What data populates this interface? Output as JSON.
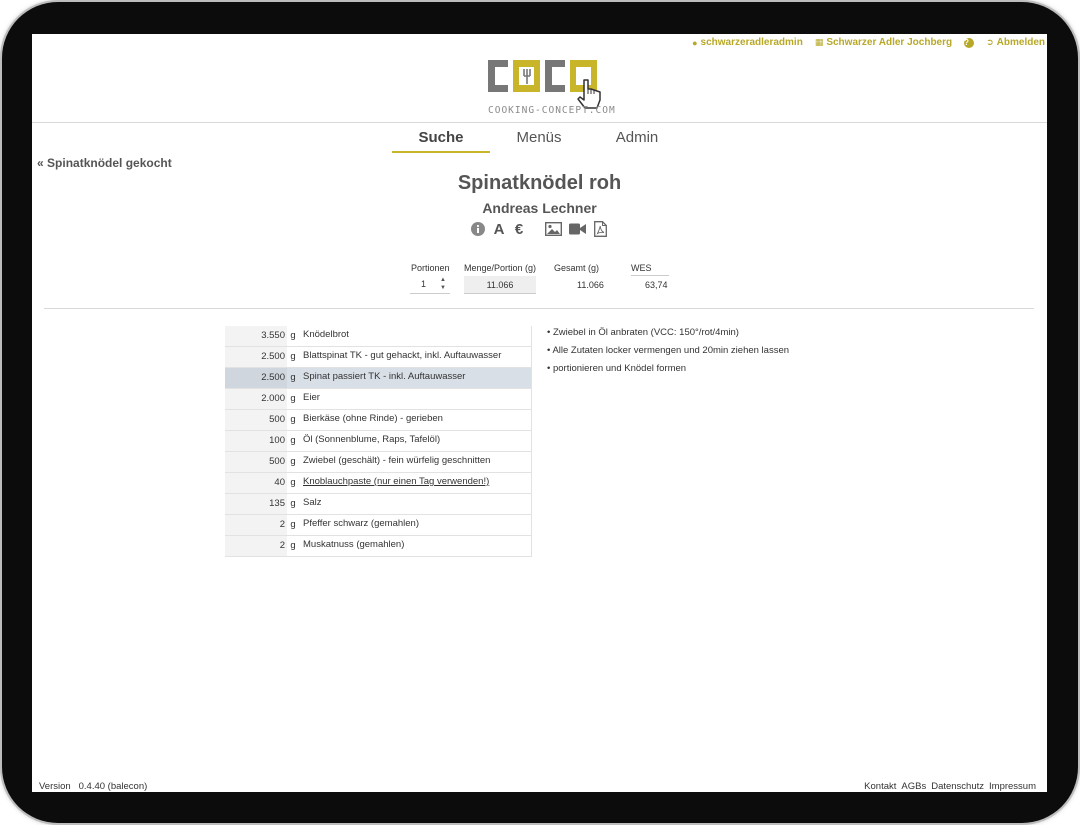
{
  "userbar": {
    "username": "schwarzeradleradmin",
    "hotel": "Schwarzer Adler Jochberg",
    "help": "?",
    "logout": "Abmelden"
  },
  "logo": {
    "subtitle": "COOKING-CONCEPT.COM"
  },
  "nav": {
    "tabs": [
      {
        "label": "Suche",
        "active": true
      },
      {
        "label": "Menüs"
      },
      {
        "label": "Admin"
      }
    ]
  },
  "back": {
    "label": "Spinatknödel gekocht"
  },
  "recipe": {
    "title": "Spinatknödel roh",
    "author": "Andreas Lechner",
    "icons": {
      "allergen_letter": "A",
      "price_symbol": "€"
    }
  },
  "portions": {
    "headers": {
      "portionen": "Portionen",
      "menge": "Menge/Portion (g)",
      "gesamt": "Gesamt (g)",
      "wes": "WES"
    },
    "values": {
      "portionen": "1",
      "menge": "11.066",
      "gesamt": "11.066",
      "wes": "63,74"
    }
  },
  "ingredients": [
    {
      "qty": "3.550",
      "unit": "g",
      "name": "Knödelbrot"
    },
    {
      "qty": "2.500",
      "unit": "g",
      "name": "Blattspinat TK - gut gehackt, inkl. Auftauwasser"
    },
    {
      "qty": "2.500",
      "unit": "g",
      "name": "Spinat passiert TK - inkl. Auftauwasser",
      "highlight": true
    },
    {
      "qty": "2.000",
      "unit": "g",
      "name": "Eier"
    },
    {
      "qty": "500",
      "unit": "g",
      "name": "Bierkäse (ohne Rinde) - gerieben"
    },
    {
      "qty": "100",
      "unit": "g",
      "name": "Öl (Sonnenblume, Raps, Tafelöl)"
    },
    {
      "qty": "500",
      "unit": "g",
      "name": "Zwiebel (geschält) - fein würfelig geschnitten"
    },
    {
      "qty": "40",
      "unit": "g",
      "name": "Knoblauchpaste (nur einen Tag verwenden!)",
      "link": true
    },
    {
      "qty": "135",
      "unit": "g",
      "name": "Salz"
    },
    {
      "qty": "2",
      "unit": "g",
      "name": "Pfeffer schwarz (gemahlen)"
    },
    {
      "qty": "2",
      "unit": "g",
      "name": "Muskatnuss (gemahlen)"
    }
  ],
  "steps": [
    "• Zwiebel in Öl anbraten (VCC: 150°/rot/4min)",
    "• Alle Zutaten locker vermengen und 20min ziehen lassen",
    "• portionieren und Knödel formen"
  ],
  "footer": {
    "version_label": "Version",
    "version": "0.4.40 (balecon)",
    "links": [
      "Kontakt",
      "AGBs",
      "Datenschutz",
      "Impressum"
    ]
  },
  "colors": {
    "accent": "#c9b52a",
    "text": "#333333",
    "logo_gray": "#777777"
  }
}
